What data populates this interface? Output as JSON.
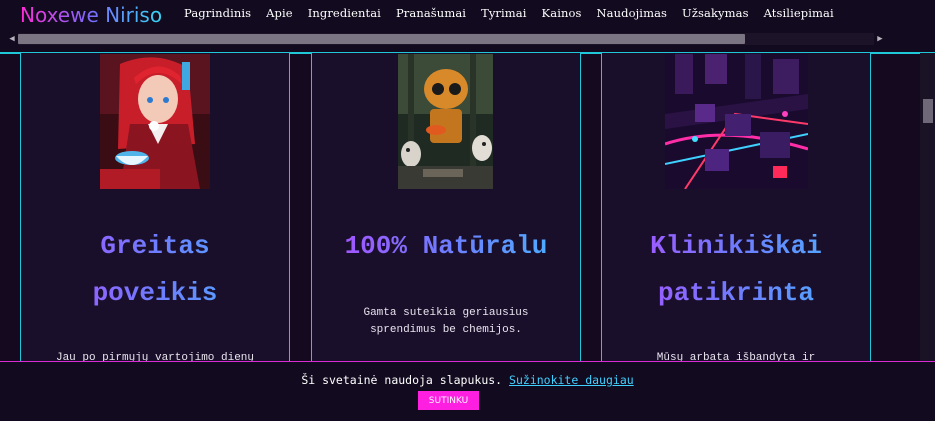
{
  "header": {
    "logo": "Noxewe Niriso",
    "nav": [
      "Pagrindinis",
      "Apie",
      "Ingredientai",
      "Pranašumai",
      "Tyrimai",
      "Kainos",
      "Naudojimas",
      "Užsakymas",
      "Atsiliepimai"
    ]
  },
  "cards": [
    {
      "title_line1": "Greitas",
      "title_line2": "poveikis",
      "text_line1": "Jau po pirmųjų vartojimo dienų",
      "text_line2": "",
      "image": "anime-girl-with-tea-cup"
    },
    {
      "title_line1": "100% Natūralu",
      "title_line2": "",
      "text_line1": "Gamta suteikia geriausius",
      "text_line2": "sprendimus be chemijos.",
      "image": "robot-with-tea-and-owls"
    },
    {
      "title_line1": "Klinikiškai",
      "title_line2": "patikrinta",
      "text_line1": "Mūsų arbata išbandyta ir",
      "text_line2": "",
      "image": "neon-city-circuit"
    }
  ],
  "cookie": {
    "message": "Ši svetainė naudoja slapukus.",
    "link": "Sužinokite daugiau",
    "button": "SUTINKU"
  },
  "colors": {
    "accent_cyan": "#1fc7d9",
    "accent_pink": "#ff1fe0",
    "background": "#14091f"
  }
}
